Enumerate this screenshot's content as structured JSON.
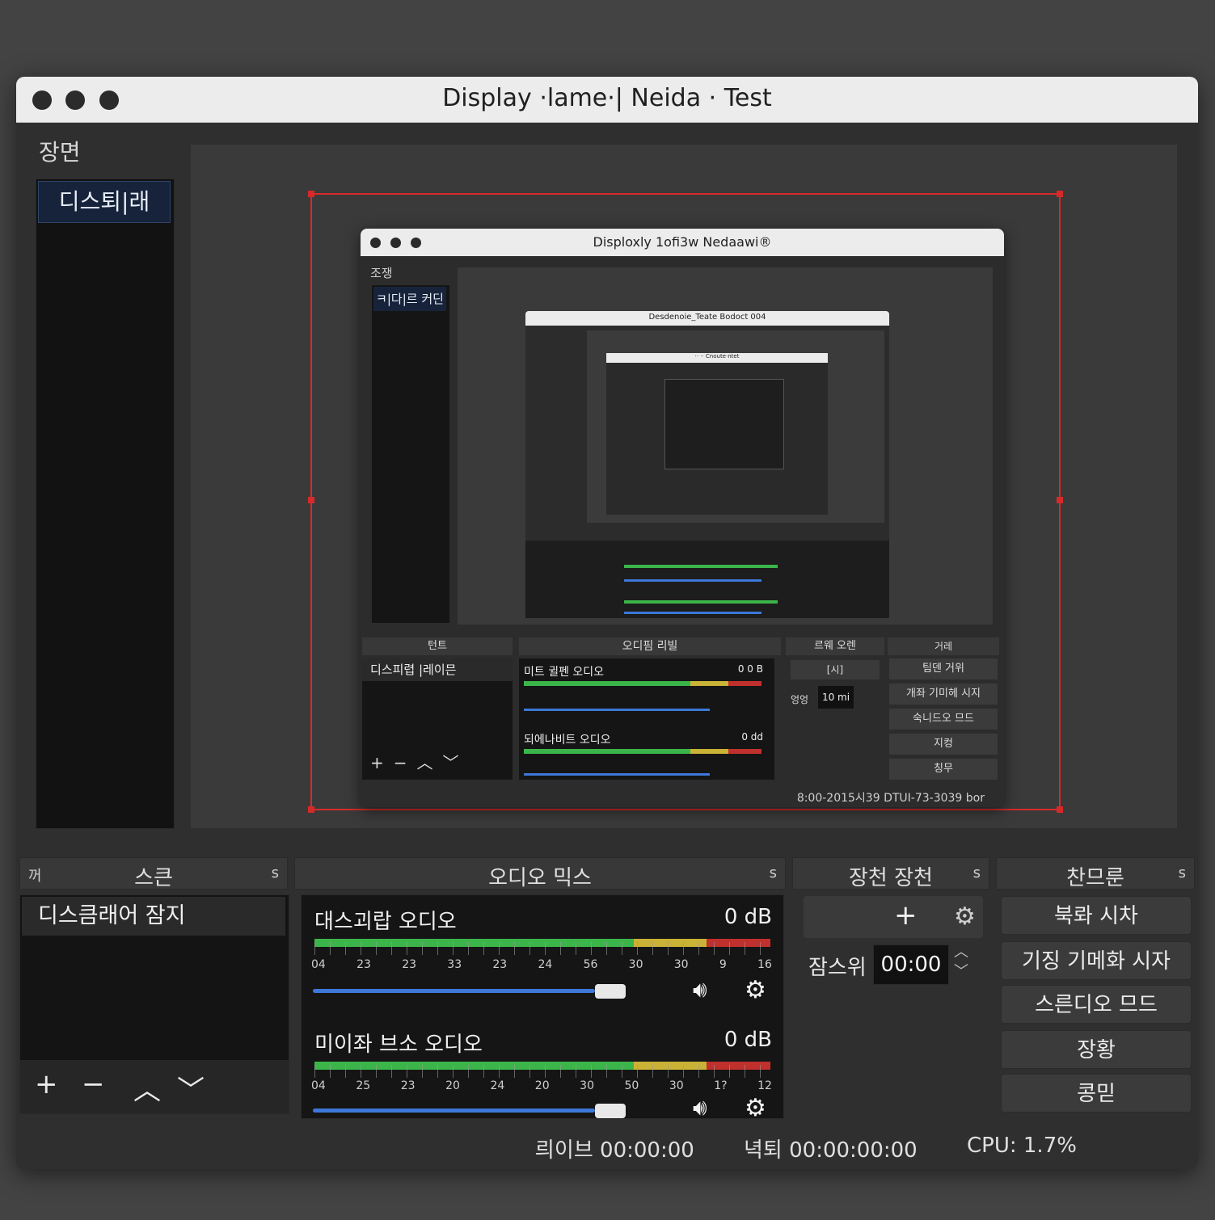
{
  "window": {
    "title": "Display ·lame·| Neida · Test"
  },
  "scenes": {
    "label": "장면",
    "items": [
      "디스퇴|래"
    ]
  },
  "preview": {
    "nested_title": "Disploxly 1ofi3w  Nedaawi®",
    "nested_scenes_label": "조쟁",
    "nested_scene_item": "ㅋ|다|르 커딘",
    "nested_panels": [
      "턴트",
      "오디핌 리빌",
      "르웨 오렌",
      "거레"
    ],
    "nested_source": "디스피렵 |레이믄",
    "nested_ch1": "미트 귈펜 오디오",
    "nested_ch1_db": "0 0 B",
    "nested_ch2": "되에나비트 오디오",
    "nested_ch2_db": "0 dd",
    "nested_trans_label": "[시]",
    "nested_duration_label": "엉엉",
    "nested_duration": "10 mi",
    "nested_controls": [
      "팀덴 거위",
      "개좌 기미헤 시지",
      "숙니드오 므드",
      "지컹",
      "칭무"
    ],
    "nested_status": "8:00-2015시39   DTUI-73-3039 bor",
    "nested2_title": "Desdenoie_Teate Bodoct 004",
    "nested3_title": "·· ·· Cnoute·ntet"
  },
  "sources": {
    "title": "스큰",
    "items": [
      "디스큼래어 잠지"
    ],
    "tools": [
      "+",
      "−",
      "︿",
      "﹀"
    ]
  },
  "mixer": {
    "title": "오디오 믹스",
    "channels": [
      {
        "name": "대스괴랍 오디오",
        "db": "0 dB",
        "ticks": [
          "04",
          "23",
          "23",
          "33",
          "23",
          "24",
          "56",
          "30",
          "30",
          "9",
          "16"
        ],
        "volume": 0.83
      },
      {
        "name": "미이좌 브소 오디오",
        "db": "0 dB",
        "ticks": [
          "04",
          "25",
          "23",
          "20",
          "24",
          "20",
          "30",
          "50",
          "30",
          "1?",
          "12"
        ],
        "volume": 0.83
      }
    ]
  },
  "transitions": {
    "title": "장천 장천",
    "add": "+",
    "duration_label": "잠스위",
    "duration_value": "00:00"
  },
  "controls": {
    "title": "찬므룬",
    "buttons": [
      "북롸 시차",
      "기징 기메화 시자",
      "스른디오 므드",
      "장황",
      "콩믿"
    ]
  },
  "status": {
    "live": "릐이브 00:00:00",
    "rec": "녁퇴 00:00:00:00",
    "cpu": "CPU: 1.7%"
  },
  "panel_corner": "s",
  "panel_corner_left": "꺼",
  "colors": {
    "selection": "#d62a2a",
    "fader": "#3d78d8",
    "meter_green": "#3bb54a",
    "meter_yellow": "#c9b235",
    "meter_red": "#c0302c"
  }
}
